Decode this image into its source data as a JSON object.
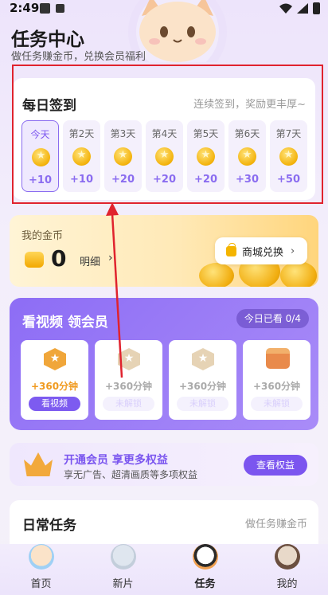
{
  "status": {
    "time": "2:49"
  },
  "header": {
    "title": "任务中心",
    "subtitle": "做任务赚金币，兑换会员福利"
  },
  "checkin": {
    "title": "每日签到",
    "subtitle": "连续签到，奖励更丰厚~",
    "days": [
      {
        "label": "今天",
        "reward": "+10",
        "today": true
      },
      {
        "label": "第2天",
        "reward": "+10"
      },
      {
        "label": "第3天",
        "reward": "+20"
      },
      {
        "label": "第4天",
        "reward": "+20"
      },
      {
        "label": "第5天",
        "reward": "+20"
      },
      {
        "label": "第6天",
        "reward": "+30"
      },
      {
        "label": "第7天",
        "reward": "+50"
      }
    ]
  },
  "coins": {
    "title": "我的金币",
    "amount": "0",
    "detail_label": "明细",
    "mall_label": "商城兑换"
  },
  "video": {
    "title": "看视频 领会员",
    "badge": "今日已看 0/4",
    "tiles": [
      {
        "duration": "+360分钟",
        "button": "看视频",
        "active": true,
        "icon": "medal-icon"
      },
      {
        "duration": "+360分钟",
        "button": "未解锁",
        "icon": "medal-icon"
      },
      {
        "duration": "+360分钟",
        "button": "未解锁",
        "icon": "medal-icon"
      },
      {
        "duration": "+360分钟",
        "button": "未解锁",
        "icon": "treasure-chest-icon"
      }
    ]
  },
  "vip": {
    "title": "开通会员 享更多权益",
    "subtitle": "享无广告、超清画质等多项权益",
    "button": "查看权益"
  },
  "daily": {
    "title": "日常任务",
    "subtitle": "做任务赚金币"
  },
  "nav": [
    {
      "label": "首页"
    },
    {
      "label": "新片"
    },
    {
      "label": "任务",
      "active": true
    },
    {
      "label": "我的"
    }
  ],
  "colors": {
    "accent": "#7b55ef",
    "highlight": "#e0232e",
    "coin": "#f4b400"
  }
}
